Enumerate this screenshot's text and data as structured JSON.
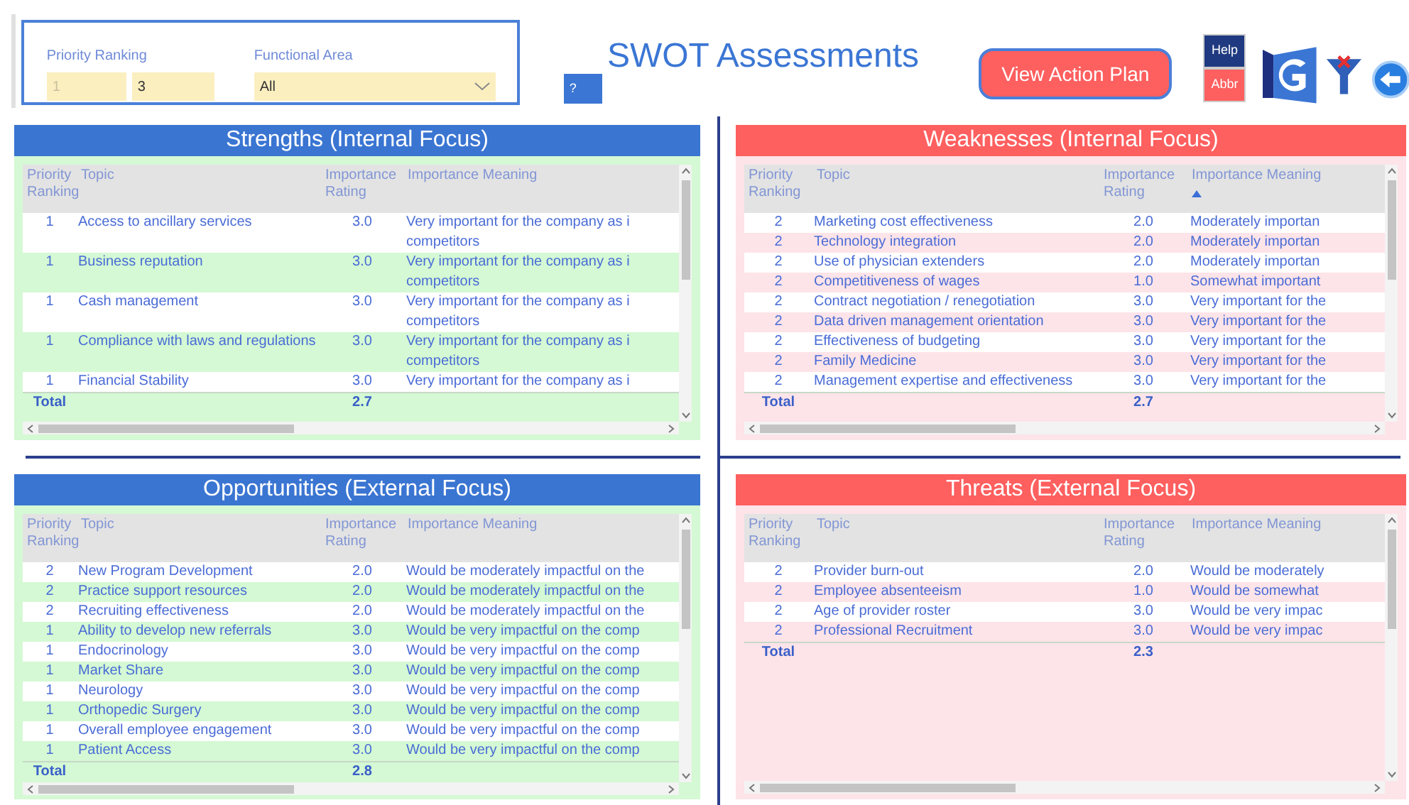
{
  "filters": {
    "priority_ranking": {
      "label": "Priority Ranking",
      "min": {
        "placeholder": "1"
      },
      "max": {
        "value": "3"
      }
    },
    "functional_area": {
      "label": "Functional Area",
      "value": "All"
    }
  },
  "info_button": "?",
  "title": "SWOT Assessments",
  "action_button": "View Action Plan",
  "help_button": "Help",
  "abbr_button": "Abbr",
  "panels": [
    {
      "title": "Strengths (Internal Focus)",
      "kind": "positive",
      "columns": [
        {
          "label": "Priority Ranking",
          "sorted": false
        },
        {
          "label": "Topic",
          "sorted": false
        },
        {
          "label": "Importance Rating",
          "sorted": false
        },
        {
          "label": "Importance Meaning",
          "sorted": false
        }
      ],
      "rows": [
        {
          "ranking": "1",
          "topic": "Access to ancillary services",
          "rating": "3.0",
          "meaning": [
            "Very important for the company as i",
            "competitors"
          ]
        },
        {
          "ranking": "1",
          "topic": "Business reputation",
          "rating": "3.0",
          "meaning": [
            "Very important for the company as i",
            "competitors"
          ]
        },
        {
          "ranking": "1",
          "topic": "Cash management",
          "rating": "3.0",
          "meaning": [
            "Very important for the company as i",
            "competitors"
          ]
        },
        {
          "ranking": "1",
          "topic": "Compliance with laws and regulations",
          "rating": "3.0",
          "meaning": [
            "Very important for the company as i",
            "competitors"
          ]
        },
        {
          "ranking": "1",
          "topic": "Financial Stability",
          "rating": "3.0",
          "meaning": [
            "Very important for the company as i"
          ]
        }
      ],
      "total": {
        "label": "Total",
        "rating": "2.7"
      }
    },
    {
      "title": "Weaknesses (Internal Focus)",
      "kind": "negative",
      "columns": [
        {
          "label": "Priority Ranking",
          "sorted": false
        },
        {
          "label": "Topic",
          "sorted": false
        },
        {
          "label": "Importance Rating",
          "sorted": false
        },
        {
          "label": "Importance Meaning",
          "sorted": true
        }
      ],
      "rows": [
        {
          "ranking": "2",
          "topic": "Marketing cost effectiveness",
          "rating": "2.0",
          "meaning": [
            "Moderately importan"
          ]
        },
        {
          "ranking": "2",
          "topic": "Technology integration",
          "rating": "2.0",
          "meaning": [
            "Moderately importan"
          ]
        },
        {
          "ranking": "2",
          "topic": "Use of physician extenders",
          "rating": "2.0",
          "meaning": [
            "Moderately importan"
          ]
        },
        {
          "ranking": "2",
          "topic": "Competitiveness of wages",
          "rating": "1.0",
          "meaning": [
            "Somewhat important"
          ]
        },
        {
          "ranking": "2",
          "topic": "Contract negotiation / renegotiation",
          "rating": "3.0",
          "meaning": [
            "Very important for the"
          ]
        },
        {
          "ranking": "2",
          "topic": "Data driven management orientation",
          "rating": "3.0",
          "meaning": [
            "Very important for the"
          ]
        },
        {
          "ranking": "2",
          "topic": "Effectiveness of budgeting",
          "rating": "3.0",
          "meaning": [
            "Very important for the"
          ]
        },
        {
          "ranking": "2",
          "topic": "Family Medicine",
          "rating": "3.0",
          "meaning": [
            "Very important for the"
          ]
        },
        {
          "ranking": "2",
          "topic": "Management expertise and effectiveness",
          "rating": "3.0",
          "meaning": [
            "Very important for the"
          ]
        }
      ],
      "total": {
        "label": "Total",
        "rating": "2.7"
      }
    },
    {
      "title": "Opportunities (External Focus)",
      "kind": "positive",
      "columns": [
        {
          "label": "Priority Ranking",
          "sorted": false
        },
        {
          "label": "Topic",
          "sorted": false
        },
        {
          "label": "Importance Rating",
          "sorted": false
        },
        {
          "label": "Importance Meaning",
          "sorted": false
        }
      ],
      "rows": [
        {
          "ranking": "2",
          "topic": "New Program Development",
          "rating": "2.0",
          "meaning": [
            "Would be moderately impactful on the"
          ]
        },
        {
          "ranking": "2",
          "topic": "Practice support resources",
          "rating": "2.0",
          "meaning": [
            "Would be moderately impactful on the"
          ]
        },
        {
          "ranking": "2",
          "topic": "Recruiting effectiveness",
          "rating": "2.0",
          "meaning": [
            "Would be moderately impactful on the"
          ]
        },
        {
          "ranking": "1",
          "topic": "Ability to develop new referrals",
          "rating": "3.0",
          "meaning": [
            "Would be very impactful on the comp"
          ]
        },
        {
          "ranking": "1",
          "topic": "Endocrinology",
          "rating": "3.0",
          "meaning": [
            "Would be very impactful on the comp"
          ]
        },
        {
          "ranking": "1",
          "topic": "Market Share",
          "rating": "3.0",
          "meaning": [
            "Would be very impactful on the comp"
          ]
        },
        {
          "ranking": "1",
          "topic": "Neurology",
          "rating": "3.0",
          "meaning": [
            "Would be very impactful on the comp"
          ]
        },
        {
          "ranking": "1",
          "topic": "Orthopedic Surgery",
          "rating": "3.0",
          "meaning": [
            "Would be very impactful on the comp"
          ]
        },
        {
          "ranking": "1",
          "topic": "Overall employee engagement",
          "rating": "3.0",
          "meaning": [
            "Would be very impactful on the comp"
          ]
        },
        {
          "ranking": "1",
          "topic": "Patient Access",
          "rating": "3.0",
          "meaning": [
            "Would be very impactful on the comp"
          ]
        }
      ],
      "total": {
        "label": "Total",
        "rating": "2.8"
      }
    },
    {
      "title": "Threats (External Focus)",
      "kind": "negative",
      "columns": [
        {
          "label": "Priority Ranking",
          "sorted": false
        },
        {
          "label": "Topic",
          "sorted": false
        },
        {
          "label": "Importance Rating",
          "sorted": false
        },
        {
          "label": "Importance Meaning",
          "sorted": false
        }
      ],
      "rows": [
        {
          "ranking": "2",
          "topic": "Provider burn-out",
          "rating": "2.0",
          "meaning": [
            "Would be moderately"
          ]
        },
        {
          "ranking": "2",
          "topic": "Employee absenteeism",
          "rating": "1.0",
          "meaning": [
            "Would be somewhat"
          ]
        },
        {
          "ranking": "2",
          "topic": "Age of provider roster",
          "rating": "3.0",
          "meaning": [
            "Would be very impac"
          ]
        },
        {
          "ranking": "2",
          "topic": "Professional Recruitment",
          "rating": "3.0",
          "meaning": [
            "Would be very impac"
          ]
        }
      ],
      "total": {
        "label": "Total",
        "rating": "2.3"
      }
    }
  ]
}
